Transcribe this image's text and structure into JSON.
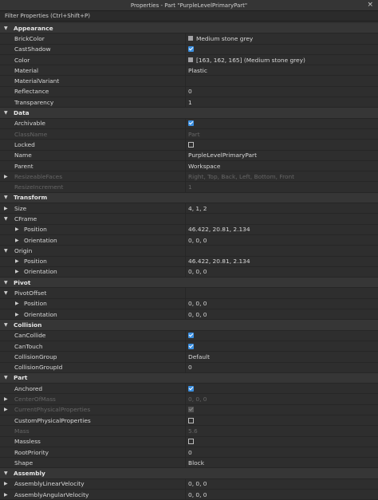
{
  "window": {
    "title": "Properties - Part \"PurpleLevelPrimaryPart\"",
    "close_label": "×"
  },
  "filter": {
    "placeholder": "Filter Properties (Ctrl+Shift+P)"
  },
  "colors": {
    "stone_grey": "#a3a2a5",
    "accent": "#3b8fe0"
  },
  "rows": [
    {
      "kind": "cat",
      "label": "Appearance"
    },
    {
      "kind": "prop",
      "name": "BrickColor",
      "value": "Medium stone grey",
      "swatch": true
    },
    {
      "kind": "prop",
      "name": "CastShadow",
      "check": "on"
    },
    {
      "kind": "prop",
      "name": "Color",
      "value": "[163, 162, 165] (Medium stone grey)",
      "swatch": true
    },
    {
      "kind": "prop",
      "name": "Material",
      "value": "Plastic"
    },
    {
      "kind": "prop",
      "name": "MaterialVariant",
      "value": ""
    },
    {
      "kind": "prop",
      "name": "Reflectance",
      "value": "0"
    },
    {
      "kind": "prop",
      "name": "Transparency",
      "value": "1"
    },
    {
      "kind": "cat",
      "label": "Data"
    },
    {
      "kind": "prop",
      "name": "Archivable",
      "check": "on"
    },
    {
      "kind": "prop",
      "name": "ClassName",
      "value": "Part",
      "dim": true
    },
    {
      "kind": "prop",
      "name": "Locked",
      "check": "off"
    },
    {
      "kind": "prop",
      "name": "Name",
      "value": "PurpleLevelPrimaryPart"
    },
    {
      "kind": "prop",
      "name": "Parent",
      "value": "Workspace"
    },
    {
      "kind": "prop",
      "name": "ResizeableFaces",
      "value": "Right, Top, Back, Left, Bottom, Front",
      "dim": true,
      "side": true
    },
    {
      "kind": "prop",
      "name": "ResizeIncrement",
      "value": "1",
      "dim": true
    },
    {
      "kind": "cat",
      "label": "Transform"
    },
    {
      "kind": "prop",
      "name": "Size",
      "value": "4, 1, 2",
      "side": true
    },
    {
      "kind": "prop",
      "name": "CFrame",
      "value": "",
      "side": "open"
    },
    {
      "kind": "sub",
      "name": "Position",
      "value": "46.422, 20.81, 2.134"
    },
    {
      "kind": "sub",
      "name": "Orientation",
      "value": "0, 0, 0"
    },
    {
      "kind": "prop",
      "name": "Origin",
      "value": "",
      "side": "open"
    },
    {
      "kind": "sub",
      "name": "Position",
      "value": "46.422, 20.81, 2.134"
    },
    {
      "kind": "sub",
      "name": "Orientation",
      "value": "0, 0, 0"
    },
    {
      "kind": "cat",
      "label": "Pivot"
    },
    {
      "kind": "prop",
      "name": "PivotOffset",
      "value": "",
      "side": "open"
    },
    {
      "kind": "sub",
      "name": "Position",
      "value": "0, 0, 0"
    },
    {
      "kind": "sub",
      "name": "Orientation",
      "value": "0, 0, 0"
    },
    {
      "kind": "cat",
      "label": "Collision"
    },
    {
      "kind": "prop",
      "name": "CanCollide",
      "check": "on"
    },
    {
      "kind": "prop",
      "name": "CanTouch",
      "check": "on"
    },
    {
      "kind": "prop",
      "name": "CollisionGroup",
      "value": "Default"
    },
    {
      "kind": "prop",
      "name": "CollisionGroupId",
      "value": "0"
    },
    {
      "kind": "cat",
      "label": "Part"
    },
    {
      "kind": "prop",
      "name": "Anchored",
      "check": "on"
    },
    {
      "kind": "prop",
      "name": "CenterOfMass",
      "value": "0, 0, 0",
      "dim": true,
      "side": true
    },
    {
      "kind": "prop",
      "name": "CurrentPhysicalProperties",
      "check": "dim",
      "dim": true,
      "side": true
    },
    {
      "kind": "prop",
      "name": "CustomPhysicalProperties",
      "check": "off"
    },
    {
      "kind": "prop",
      "name": "Mass",
      "value": "5.6",
      "dim": true
    },
    {
      "kind": "prop",
      "name": "Massless",
      "check": "off"
    },
    {
      "kind": "prop",
      "name": "RootPriority",
      "value": "0"
    },
    {
      "kind": "prop",
      "name": "Shape",
      "value": "Block"
    },
    {
      "kind": "cat",
      "label": "Assembly"
    },
    {
      "kind": "prop",
      "name": "AssemblyLinearVelocity",
      "value": "0, 0, 0",
      "side": true
    },
    {
      "kind": "prop",
      "name": "AssemblyAngularVelocity",
      "value": "0, 0, 0",
      "side": true
    }
  ]
}
